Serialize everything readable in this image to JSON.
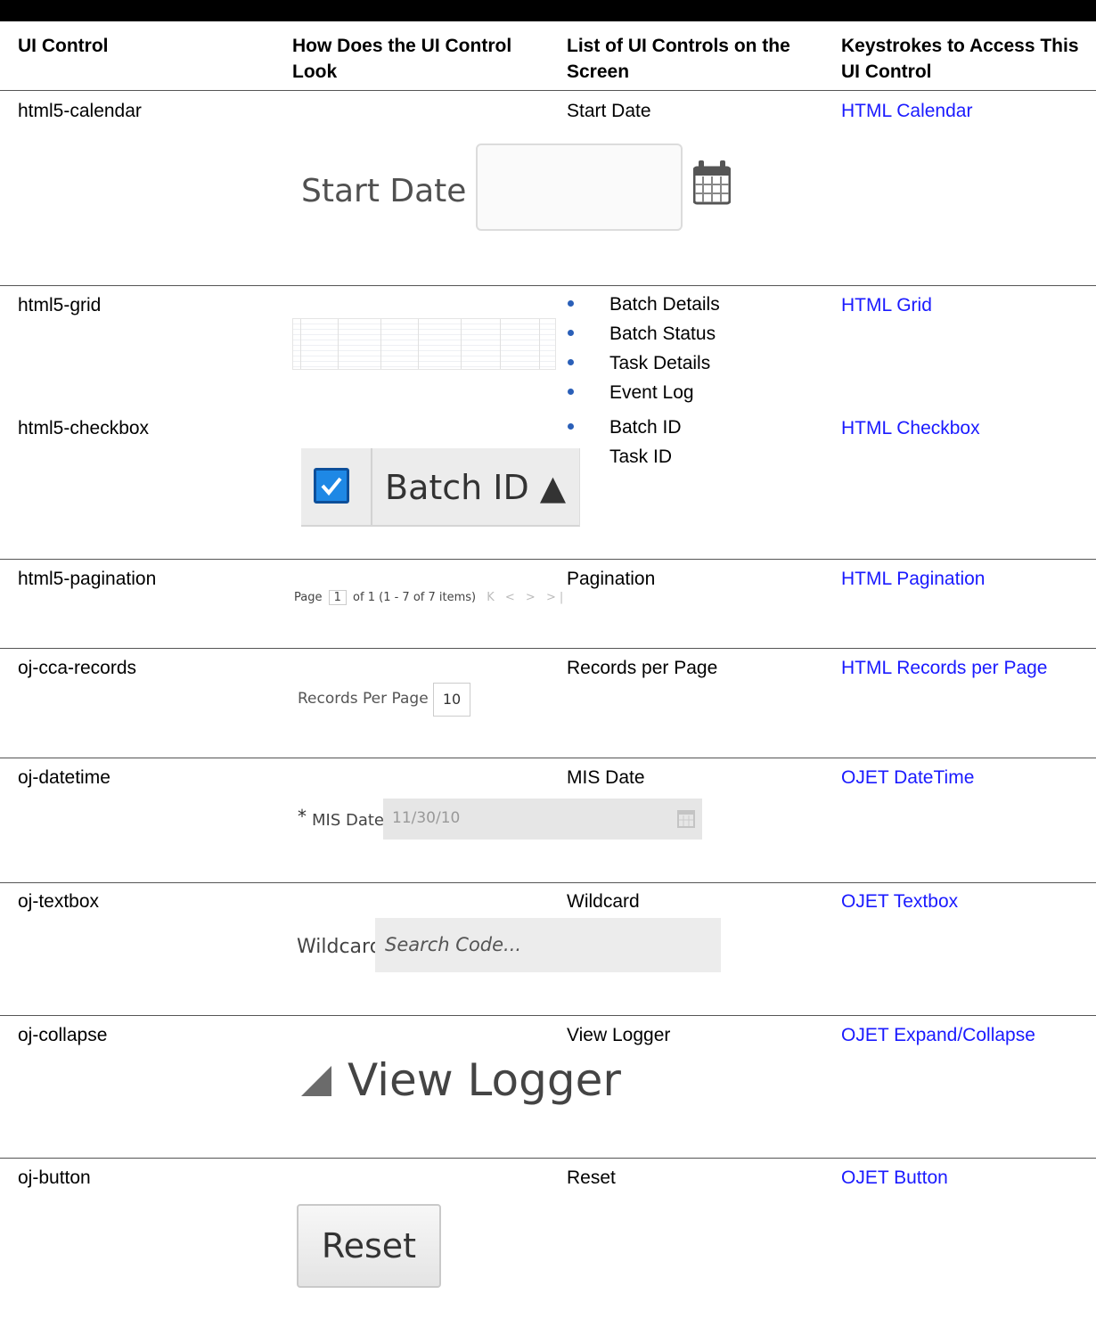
{
  "headers": {
    "col1": "UI Control",
    "col2": "How Does the UI Control Look",
    "col3": "List of UI Controls on the Screen",
    "col4": "Keystrokes to Access This UI Control"
  },
  "rows": [
    {
      "control": "html5-calendar",
      "list": [
        "Start Date"
      ],
      "link": "HTML Calendar"
    },
    {
      "control": "html5-grid",
      "list": [
        "Batch Details",
        "Batch Status",
        "Task Details",
        "Event Log"
      ],
      "link": "HTML Grid"
    },
    {
      "control": "html5-checkbox",
      "list": [
        "Batch ID",
        "Task ID"
      ],
      "link": "HTML Checkbox"
    },
    {
      "control": "html5-pagination",
      "list": [
        "Pagination"
      ],
      "link": "HTML Pagination"
    },
    {
      "control": "oj-cca-records",
      "list": [
        "Records per Page"
      ],
      "link": "HTML Records per Page"
    },
    {
      "control": "oj-datetime",
      "list": [
        "MIS Date"
      ],
      "link": "OJET DateTime"
    },
    {
      "control": "oj-textbox",
      "list": [
        "Wildcard"
      ],
      "link": "OJET Textbox"
    },
    {
      "control": "oj-collapse",
      "list": [
        "View Logger"
      ],
      "link": "OJET Expand/Collapse"
    },
    {
      "control": "oj-button",
      "list": [
        "Reset"
      ],
      "link": "OJET Button"
    }
  ],
  "illustrations": {
    "calendar": {
      "label": "Start Date",
      "icon": "calendar-icon"
    },
    "checkbox": {
      "label": "Batch ID ▲"
    },
    "pagination": {
      "prefix": "Page",
      "page": "1",
      "of": "of 1",
      "range": "(1 - 7 of  7  items)",
      "nav": "K < > >|"
    },
    "records": {
      "label": "Records Per Page",
      "value": "10"
    },
    "datetime": {
      "star": "*",
      "label": "MIS Date",
      "value": "11/30/10"
    },
    "textbox": {
      "label": "Wildcard",
      "placeholder": "Search Code..."
    },
    "collapse": {
      "label": "View Logger"
    },
    "button": {
      "label": "Reset"
    }
  }
}
